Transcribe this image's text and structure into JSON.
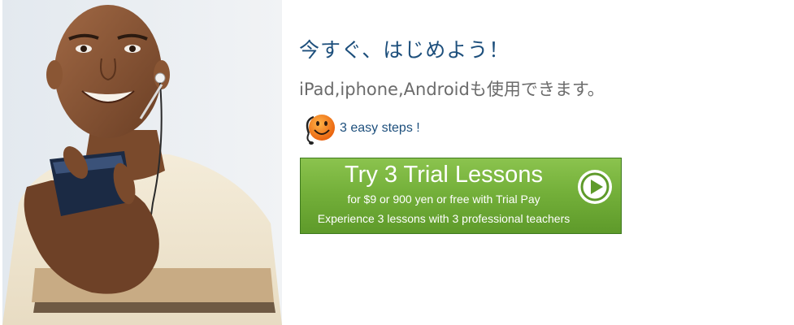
{
  "hero": {
    "photo_icon": "smiling-man-with-smartphone-and-earphones"
  },
  "headline": "今すぐ、はじめよう！",
  "subline": "iPad,iphone,Androidも使用できます。",
  "steps": {
    "icon": "smiley-headset-icon",
    "label": "3 easy steps !"
  },
  "cta": {
    "title": "Try 3 Trial Lessons",
    "price": "for $9 or 900 yen or free with Trial Pay",
    "description": "Experience 3 lessons with 3 professional teachers",
    "icon": "play-arrow-icon"
  },
  "colors": {
    "headline": "#1d4f7c",
    "subline": "#6b6b6b",
    "cta_green": "#74b03a",
    "smiley_orange": "#f36a10"
  }
}
